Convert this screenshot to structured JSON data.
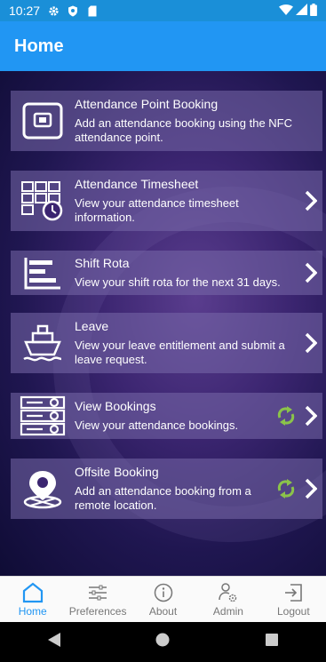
{
  "status": {
    "time": "10:27"
  },
  "appbar": {
    "title": "Home"
  },
  "cards": [
    {
      "title": "Attendance Point Booking",
      "desc": "Add an attendance booking using the NFC attendance point."
    },
    {
      "title": "Attendance Timesheet",
      "desc": "View your attendance timesheet information."
    },
    {
      "title": "Shift Rota",
      "desc": "View your shift rota for the next 31 days."
    },
    {
      "title": "Leave",
      "desc": "View your leave entitlement and submit a leave request."
    },
    {
      "title": "View Bookings",
      "desc": "View your attendance bookings."
    },
    {
      "title": "Offsite Booking",
      "desc": "Add an attendance booking from a remote location."
    }
  ],
  "nav": [
    {
      "label": "Home"
    },
    {
      "label": "Preferences"
    },
    {
      "label": "About"
    },
    {
      "label": "Admin"
    },
    {
      "label": "Logout"
    }
  ],
  "colors": {
    "primary": "#2196f3",
    "status": "#1a8fd8",
    "sync": "#8bc34a"
  }
}
